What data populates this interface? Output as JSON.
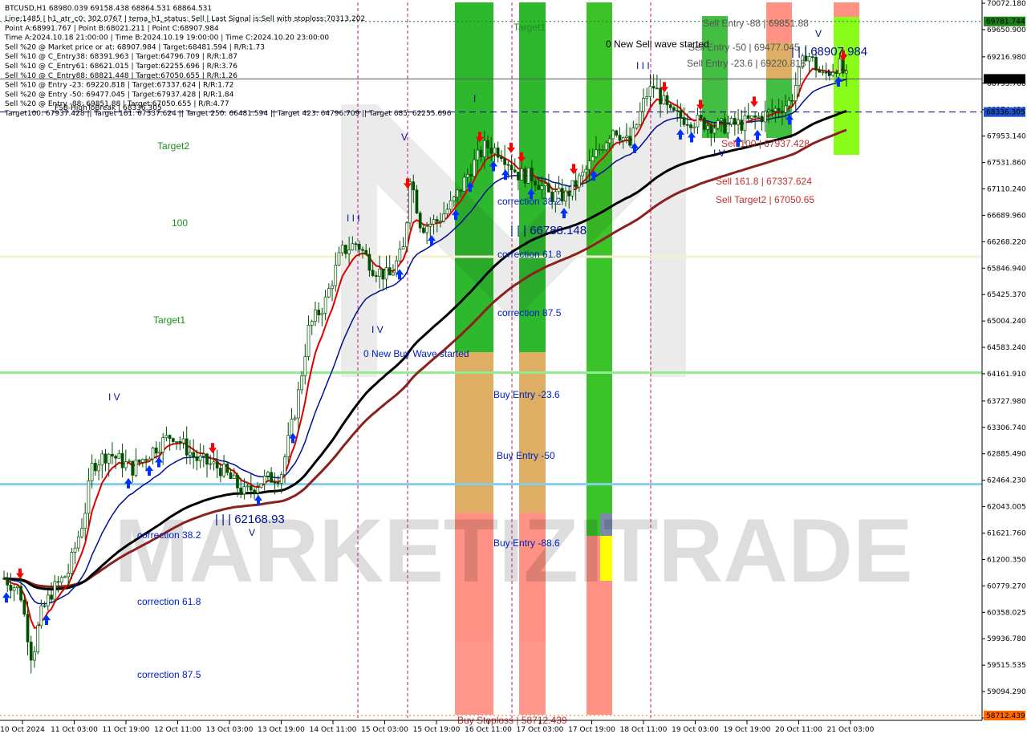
{
  "header": {
    "symbol_line": "BTCUSD,H1  68980.039 69158.438 68864.531 68864.531",
    "lines": [
      "Line:1485 | h1_atr_c0: 302.0767 | tema_h1_status: Sell | Last Signal is:Sell with stoploss:70313.202",
      "Point A:68991.767 | Point B:68021.211 | Point C:68907.984",
      "Time A:2024.10.18 21:00:00 | Time B:2024.10.19 19:00:00 | Time C:2024.10.20 23:00:00",
      "Sell %20 @ Market price or at: 68907.984 | Target:68481.594 | R/R:1.73",
      "Sell %10 @ C_Entry38: 68391.963 | Target:64796.709 | R/R:1.87",
      "Sell %10 @ C_Entry61: 68621.015 | Target:62255.696 | R/R:3.76",
      "Sell %10 @ C_Entry88: 68821.448 | Target:67050.655 | R/R:1.26",
      "Sell %10 @ Entry -23: 69220.818 | Target:67337.624 | R/R:1.72",
      "Sell %20 @ Entry -50: 69477.045 | Target:67937.428 | R/R:1.84",
      "Sell %20 @ Entry -88: 69851.88 | Target:67050.655 | R/R:4.77",
      "Target100: 67937.428 || Target 161: 67337.624 || Target 250: 66481.594 || Target 423: 64796.709 || Target 685: 62255.696"
    ],
    "fsb_label": "FSB-HighToBreak | 68336.305"
  },
  "watermark": "MARKETIZITRADE",
  "colors": {
    "bg": "#ffffff",
    "candle": "#005000",
    "ema_red": "#e00000",
    "ema_blue": "#001090",
    "ma_black": "#000000",
    "ma_brown": "#8b2020",
    "green_band": "#2eb82e",
    "lime_band": "#7cfc00",
    "orange_band": "#d49a3c",
    "salmon_band": "#ff7f6e",
    "buy_arrow": "#0030ff",
    "sell_arrow": "#ff0000",
    "hline_lightgreen": "#90ee90",
    "hline_skyblue": "#87ceeb",
    "hline_navy": "#000080",
    "price_tag_current": "#000000",
    "price_tag_blue": "#1e50c8",
    "price_tag_green": "#1a7f1a",
    "price_tag_orange": "#ff6a00"
  },
  "annotations": [
    {
      "text": "Target1",
      "color": "#1a8f1a"
    },
    {
      "text": "Target2",
      "color": "#1a8f1a"
    },
    {
      "text": "100",
      "color": "#1a8f1a"
    },
    {
      "text": "Target1",
      "color": "#1a8f1a"
    },
    {
      "text": "Sell Entry -88 | 69851.88",
      "color": "#555555"
    },
    {
      "text": "0 New Sell wave started",
      "color": "#000000"
    },
    {
      "text": "Sell Entry -50 | 69477.045",
      "color": "#555555"
    },
    {
      "text": "Sell Entry -23.6 | 69220.818",
      "color": "#555555"
    },
    {
      "text": "| | | 68907.984",
      "color": "#001090"
    },
    {
      "text": "Sell 100 | 67937.428",
      "color": "#c03030"
    },
    {
      "text": "Sell 161.8 | 67337.624",
      "color": "#c03030"
    },
    {
      "text": "Sell Target2 | 67050.65",
      "color": "#c03030"
    },
    {
      "text": "correction 38.2",
      "color": "#0020c0"
    },
    {
      "text": "| | | 66788.148",
      "color": "#001090"
    },
    {
      "text": "correction 61.8",
      "color": "#0020c0"
    },
    {
      "text": "correction 87.5",
      "color": "#0020c0"
    },
    {
      "text": "0 New Buy Wave started",
      "color": "#0020c0"
    },
    {
      "text": "Buy Entry -23.6",
      "color": "#0020c0"
    },
    {
      "text": "Buy Entry -50",
      "color": "#0020c0"
    },
    {
      "text": "Buy Entry -88.6",
      "color": "#0020c0"
    },
    {
      "text": "| | | 62168.93",
      "color": "#001090"
    },
    {
      "text": "correction 38.2",
      "color": "#0020c0"
    },
    {
      "text": "correction 61.8",
      "color": "#0020c0"
    },
    {
      "text": "correction 87.5",
      "color": "#0020c0"
    },
    {
      "text": "Buy Stoploss | 58712.439",
      "color": "#c03030"
    },
    {
      "text": "I V",
      "color": "#001090"
    },
    {
      "text": "V",
      "color": "#001090"
    },
    {
      "text": "I I I",
      "color": "#001090"
    },
    {
      "text": "I V",
      "color": "#001090"
    },
    {
      "text": "V",
      "color": "#001090"
    },
    {
      "text": "I",
      "color": "#001090"
    },
    {
      "text": "I I I",
      "color": "#001090"
    },
    {
      "text": "I V",
      "color": "#001090"
    },
    {
      "text": "V",
      "color": "#001090"
    },
    {
      "text": "I",
      "color": "#001090"
    }
  ],
  "price_tags": [
    {
      "text": "69781.744",
      "kind": "green"
    },
    {
      "text": "68864.531",
      "kind": "current"
    },
    {
      "text": "68336.305",
      "kind": "blue"
    },
    {
      "text": "58712.439",
      "kind": "orange"
    }
  ],
  "chart_data": {
    "type": "candlestick",
    "title": "BTCUSD,H1",
    "ylim": [
      58700,
      70072
    ],
    "yticks": [
      70072.18,
      69650.9,
      69216.98,
      68795.7,
      68374.42,
      67953.14,
      67531.86,
      67110.24,
      66689.96,
      66268.22,
      65846.94,
      65425.37,
      65004.24,
      64583.24,
      64161.91,
      63727.98,
      63306.74,
      62885.49,
      62464.23,
      62043.005,
      61621.76,
      61200.35,
      60779.27,
      60358.025,
      59936.78,
      59515.535,
      59094.29,
      58673.045
    ],
    "xticks": [
      "10 Oct 2024",
      "11 Oct 03:00",
      "11 Oct 19:00",
      "12 Oct 11:00",
      "13 Oct 03:00",
      "13 Oct 19:00",
      "14 Oct 11:00",
      "15 Oct 03:00",
      "15 Oct 19:00",
      "16 Oct 11:00",
      "17 Oct 03:00",
      "17 Oct 19:00",
      "18 Oct 11:00",
      "19 Oct 03:00",
      "19 Oct 19:00",
      "20 Oct 11:00",
      "21 Oct 03:00"
    ],
    "price_path": [
      [
        0,
        60900
      ],
      [
        0.02,
        60700
      ],
      [
        0.035,
        59600
      ],
      [
        0.045,
        60300
      ],
      [
        0.06,
        60700
      ],
      [
        0.08,
        61000
      ],
      [
        0.1,
        61900
      ],
      [
        0.11,
        62700
      ],
      [
        0.13,
        62900
      ],
      [
        0.16,
        62650
      ],
      [
        0.19,
        63000
      ],
      [
        0.21,
        63200
      ],
      [
        0.24,
        62800
      ],
      [
        0.27,
        62650
      ],
      [
        0.3,
        62250
      ],
      [
        0.32,
        62450
      ],
      [
        0.345,
        62550
      ],
      [
        0.365,
        63700
      ],
      [
        0.38,
        64900
      ],
      [
        0.4,
        65300
      ],
      [
        0.42,
        66100
      ],
      [
        0.44,
        66250
      ],
      [
        0.46,
        65850
      ],
      [
        0.48,
        65700
      ],
      [
        0.5,
        66200
      ],
      [
        0.505,
        67400
      ],
      [
        0.52,
        66500
      ],
      [
        0.54,
        66600
      ],
      [
        0.56,
        66900
      ],
      [
        0.58,
        67400
      ],
      [
        0.6,
        67800
      ],
      [
        0.62,
        67700
      ],
      [
        0.64,
        67350
      ],
      [
        0.66,
        67300
      ],
      [
        0.68,
        67000
      ],
      [
        0.7,
        67000
      ],
      [
        0.72,
        67300
      ],
      [
        0.74,
        67700
      ],
      [
        0.76,
        68100
      ],
      [
        0.78,
        67800
      ],
      [
        0.8,
        68600
      ],
      [
        0.81,
        68750
      ],
      [
        0.83,
        68300
      ],
      [
        0.86,
        68200
      ],
      [
        0.89,
        68100
      ],
      [
        0.92,
        68150
      ],
      [
        0.95,
        68300
      ],
      [
        0.98,
        68500
      ],
      [
        1.0,
        69300
      ],
      [
        1.02,
        68900
      ],
      [
        1.04,
        69100
      ],
      [
        1.05,
        68864
      ]
    ],
    "series": [
      {
        "name": "",
        "color": "#e00000"
      },
      {
        "name": "",
        "color": "#001090"
      },
      {
        "name": "",
        "color": "#000000"
      },
      {
        "name": "",
        "color": "#8b2020"
      }
    ],
    "hlines": [
      {
        "value": 69781.744,
        "color": "#1a7f1a",
        "style": "dotted"
      },
      {
        "value": 68864.531,
        "color": "#555555",
        "style": "solid"
      },
      {
        "value": 68336.305,
        "color": "#000080",
        "style": "dashed"
      },
      {
        "value": 66030,
        "color": "#f5f0d0",
        "style": "solid"
      },
      {
        "value": 64180,
        "color": "#90ee90",
        "style": "solid"
      },
      {
        "value": 62400,
        "color": "#87ceeb",
        "style": "solid"
      },
      {
        "value": 58712.439,
        "color": "#ff6a00",
        "style": "dotted"
      }
    ],
    "grid": false,
    "legend": "none"
  }
}
